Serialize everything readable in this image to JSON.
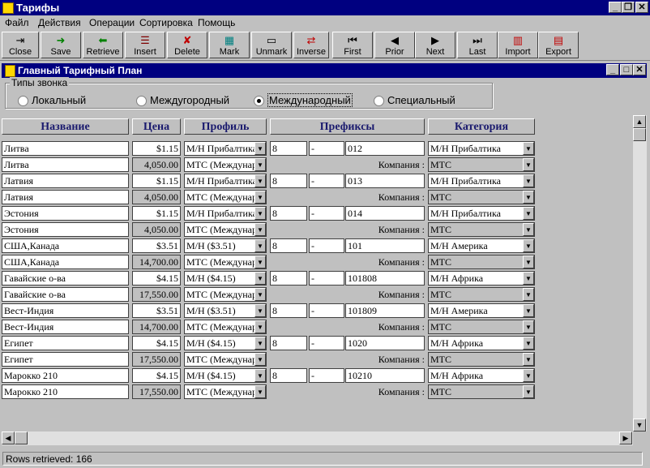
{
  "window": {
    "title": "Тарифы"
  },
  "menu": [
    "Файл",
    "Действия",
    "Операции",
    "Сортировка",
    "Помощь"
  ],
  "toolbar": [
    "Close",
    "Save",
    "Retrieve",
    "Insert",
    "Delete",
    "Mark",
    "Unmark",
    "Inverse",
    "First",
    "Prior",
    "Next",
    "Last",
    "Import",
    "Export"
  ],
  "child": {
    "title": "Главный Тарифный План"
  },
  "call_types": {
    "label": "Типы звонка",
    "options": [
      "Локальный",
      "Междугородный",
      "Международный",
      "Специальный"
    ],
    "selected": "Международный"
  },
  "columns": [
    "Название",
    "Цена",
    "Профиль",
    "Префиксы",
    "Категория"
  ],
  "company_label": "Компания :",
  "rows": [
    {
      "name": "Литва",
      "price": "$1.15",
      "profile": "М/Н Прибалтика",
      "p1": "8",
      "p2": "-",
      "p3": "012",
      "category": "М/Н Прибалтика",
      "name2": "Литва",
      "price2": "4,050.00",
      "profile2": "МТС (Междунар",
      "company": "МТС"
    },
    {
      "name": "Латвия",
      "price": "$1.15",
      "profile": "М/Н Прибалтика",
      "p1": "8",
      "p2": "-",
      "p3": "013",
      "category": "М/Н Прибалтика",
      "name2": "Латвия",
      "price2": "4,050.00",
      "profile2": "МТС (Междунар",
      "company": "МТС"
    },
    {
      "name": "Эстония",
      "price": "$1.15",
      "profile": "М/Н Прибалтика",
      "p1": "8",
      "p2": "-",
      "p3": "014",
      "category": "М/Н Прибалтика",
      "name2": "Эстония",
      "price2": "4,050.00",
      "profile2": "МТС (Междунар",
      "company": "МТС"
    },
    {
      "name": "США,Канада",
      "price": "$3.51",
      "profile": "М/Н ($3.51)",
      "p1": "8",
      "p2": "-",
      "p3": "101",
      "category": "М/Н Америка",
      "name2": "США,Канада",
      "price2": "14,700.00",
      "profile2": "МТС (Междунар",
      "company": "МТС"
    },
    {
      "name": "Гавайские о-ва",
      "price": "$4.15",
      "profile": "М/Н ($4.15)",
      "p1": "8",
      "p2": "-",
      "p3": "101808",
      "category": "М/Н Африка",
      "name2": "Гавайские о-ва",
      "price2": "17,550.00",
      "profile2": "МТС (Междунар",
      "company": "МТС"
    },
    {
      "name": "Вест-Индия",
      "price": "$3.51",
      "profile": "М/Н ($3.51)",
      "p1": "8",
      "p2": "-",
      "p3": "101809",
      "category": "М/Н Америка",
      "name2": "Вест-Индия",
      "price2": "14,700.00",
      "profile2": "МТС (Междунар",
      "company": "МТС"
    },
    {
      "name": "Египет",
      "price": "$4.15",
      "profile": "М/Н ($4.15)",
      "p1": "8",
      "p2": "-",
      "p3": "1020",
      "category": "М/Н Африка",
      "name2": "Египет",
      "price2": "17,550.00",
      "profile2": "МТС (Междунар",
      "company": "МТС"
    },
    {
      "name": "Марокко 210",
      "price": "$4.15",
      "profile": "М/Н ($4.15)",
      "p1": "8",
      "p2": "-",
      "p3": "10210",
      "category": "М/Н Африка",
      "name2": "Марокко 210",
      "price2": "17,550.00",
      "profile2": "МТС (Междунар",
      "company": "МТС"
    }
  ],
  "status": "Rows retrieved: 166"
}
